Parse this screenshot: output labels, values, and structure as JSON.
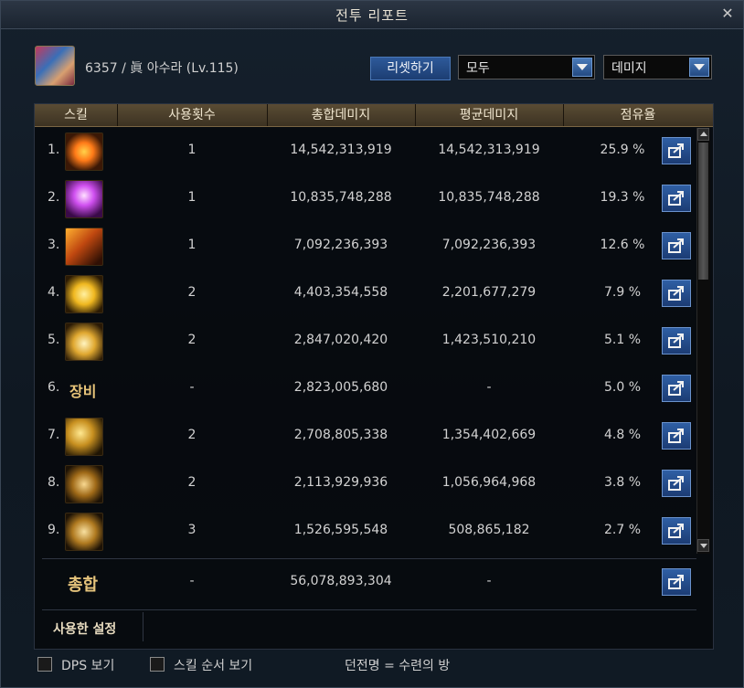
{
  "window": {
    "title": "전투 리포트",
    "close_glyph": "✕"
  },
  "header": {
    "player_info": "6357 / 眞 아수라 (Lv.115)",
    "reset_label": "리셋하기",
    "scope_select": "모두",
    "type_select": "데미지"
  },
  "table": {
    "columns": [
      "스킬",
      "사용횟수",
      "총합데미지",
      "평균데미지",
      "점유율"
    ],
    "rows": [
      {
        "rank": "1.",
        "icon": "eye-sigil-icon",
        "uses": "1",
        "total": "14,542,313,919",
        "avg": "14,542,313,919",
        "share": "25.9 %"
      },
      {
        "rank": "2.",
        "icon": "purple-burst-icon",
        "uses": "1",
        "total": "10,835,748,288",
        "avg": "10,835,748,288",
        "share": "19.3 %"
      },
      {
        "rank": "3.",
        "icon": "flame-claw-icon",
        "uses": "1",
        "total": "7,092,236,393",
        "avg": "7,092,236,393",
        "share": "12.6 %"
      },
      {
        "rank": "4.",
        "icon": "lightning-cloud-icon",
        "uses": "2",
        "total": "4,403,354,558",
        "avg": "2,201,677,279",
        "share": "7.9 %"
      },
      {
        "rank": "5.",
        "icon": "crystal-crown-icon",
        "uses": "2",
        "total": "2,847,020,420",
        "avg": "1,423,510,210",
        "share": "5.1 %"
      },
      {
        "rank": "6.",
        "icon_text": "장비",
        "uses": "-",
        "total": "2,823,005,680",
        "avg": "-",
        "share": "5.0 %"
      },
      {
        "rank": "7.",
        "icon": "wave-slash-icon",
        "uses": "2",
        "total": "2,708,805,338",
        "avg": "1,354,402,669",
        "share": "4.8 %"
      },
      {
        "rank": "8.",
        "icon": "vitruvian-circle-icon",
        "uses": "2",
        "total": "2,113,929,936",
        "avg": "1,056,964,968",
        "share": "3.8 %"
      },
      {
        "rank": "9.",
        "icon": "fighter-stance-icon",
        "uses": "3",
        "total": "1,526,595,548",
        "avg": "508,865,182",
        "share": "2.7 %"
      }
    ],
    "total": {
      "label": "총합",
      "uses": "-",
      "total": "56,078,893,304",
      "avg": "-"
    },
    "used_settings_label": "사용한 설정"
  },
  "footer": {
    "dps_label": "DPS 보기",
    "skill_order_label": "스킬 순서 보기",
    "dungeon_label": "던전명 = 수련의 방"
  },
  "colors": {
    "accent_gold": "#e6c47c",
    "button_blue": "#2f5fa4"
  }
}
